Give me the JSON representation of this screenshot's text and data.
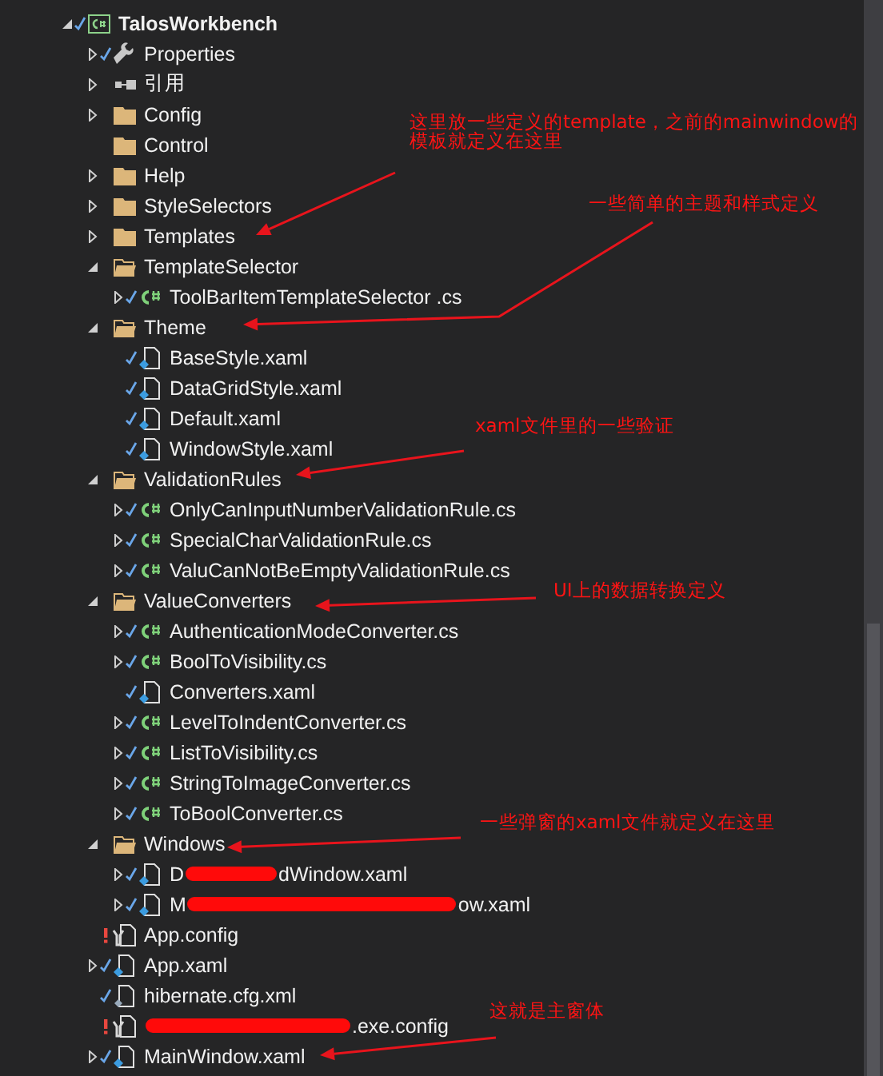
{
  "tree": [
    {
      "label": "TalosWorkbench",
      "kind": "project",
      "checked": true,
      "warning": false,
      "expanded": true,
      "children": [
        {
          "label": "Properties",
          "kind": "wrench",
          "checked": true,
          "warning": false,
          "expanded": false
        },
        {
          "label": "引用",
          "kind": "references",
          "checked": false,
          "warning": false,
          "expanded": false
        },
        {
          "label": "Config",
          "kind": "folder",
          "checked": false,
          "warning": false,
          "expanded": false
        },
        {
          "label": "Control",
          "kind": "folder",
          "checked": false,
          "warning": false
        },
        {
          "label": "Help",
          "kind": "folder",
          "checked": false,
          "warning": false,
          "expanded": false
        },
        {
          "label": "StyleSelectors",
          "kind": "folder",
          "checked": false,
          "warning": false,
          "expanded": false
        },
        {
          "label": "Templates",
          "kind": "folder",
          "checked": false,
          "warning": false,
          "expanded": false
        },
        {
          "label": "TemplateSelector",
          "kind": "folder",
          "checked": false,
          "warning": false,
          "expanded": true,
          "children": [
            {
              "label": "ToolBarItemTemplateSelector .cs",
              "kind": "csharp",
              "checked": true,
              "warning": false,
              "expanded": false
            }
          ]
        },
        {
          "label": "Theme",
          "kind": "folder",
          "checked": false,
          "warning": false,
          "expanded": true,
          "children": [
            {
              "label": "BaseStyle.xaml",
              "kind": "xaml",
              "checked": true,
              "warning": false
            },
            {
              "label": "DataGridStyle.xaml",
              "kind": "xaml",
              "checked": true,
              "warning": false
            },
            {
              "label": "Default.xaml",
              "kind": "xaml",
              "checked": true,
              "warning": false
            },
            {
              "label": "WindowStyle.xaml",
              "kind": "xaml",
              "checked": true,
              "warning": false
            }
          ]
        },
        {
          "label": "ValidationRules",
          "kind": "folder",
          "checked": false,
          "warning": false,
          "expanded": true,
          "children": [
            {
              "label": "OnlyCanInputNumberValidationRule.cs",
              "kind": "csharp",
              "checked": true,
              "warning": false,
              "expanded": false
            },
            {
              "label": "SpecialCharValidationRule.cs",
              "kind": "csharp",
              "checked": true,
              "warning": false,
              "expanded": false
            },
            {
              "label": "ValuCanNotBeEmptyValidationRule.cs",
              "kind": "csharp",
              "checked": true,
              "warning": false,
              "expanded": false
            }
          ]
        },
        {
          "label": "ValueConverters",
          "kind": "folder",
          "checked": false,
          "warning": false,
          "expanded": true,
          "children": [
            {
              "label": "AuthenticationModeConverter.cs",
              "kind": "csharp",
              "checked": true,
              "warning": false,
              "expanded": false
            },
            {
              "label": "BoolToVisibility.cs",
              "kind": "csharp",
              "checked": true,
              "warning": false,
              "expanded": false
            },
            {
              "label": "Converters.xaml",
              "kind": "xaml",
              "checked": true,
              "warning": false
            },
            {
              "label": "LevelToIndentConverter.cs",
              "kind": "csharp",
              "checked": true,
              "warning": false,
              "expanded": false
            },
            {
              "label": "ListToVisibility.cs",
              "kind": "csharp",
              "checked": true,
              "warning": false,
              "expanded": false
            },
            {
              "label": "StringToImageConverter.cs",
              "kind": "csharp",
              "checked": true,
              "warning": false,
              "expanded": false
            },
            {
              "label": "ToBoolConverter.cs",
              "kind": "csharp",
              "checked": true,
              "warning": false,
              "expanded": false
            }
          ]
        },
        {
          "label": "Windows",
          "kind": "folder",
          "checked": false,
          "warning": false,
          "expanded": true,
          "children": [
            {
              "label_start": "D",
              "label_end": "dWindow.xaml",
              "kind": "xaml",
              "checked": true,
              "warning": false,
              "expanded": false
            },
            {
              "label_start": "M",
              "label_end": "ow.xaml",
              "kind": "xaml",
              "checked": true,
              "warning": false,
              "expanded": false
            }
          ]
        },
        {
          "label": "App.config",
          "kind": "config",
          "checked": false,
          "warning": true
        },
        {
          "label": "App.xaml",
          "kind": "xaml",
          "checked": true,
          "warning": false,
          "expanded": false
        },
        {
          "label": "hibernate.cfg.xml",
          "kind": "xml",
          "checked": true,
          "warning": false
        },
        {
          "label_end": ".exe.config",
          "kind": "config",
          "checked": false,
          "warning": true
        },
        {
          "label": "MainWindow.xaml",
          "kind": "xaml",
          "checked": true,
          "warning": false,
          "expanded": false
        }
      ]
    }
  ],
  "annotations": [
    "这里放一些定义的template，之前的mainwindow的模板就定义在这里",
    "一些简单的主题和样式定义",
    "xaml文件里的一些验证",
    "UI上的数据转换定义",
    "一些弹窗的xaml文件就定义在这里",
    "这就是主窗体"
  ]
}
